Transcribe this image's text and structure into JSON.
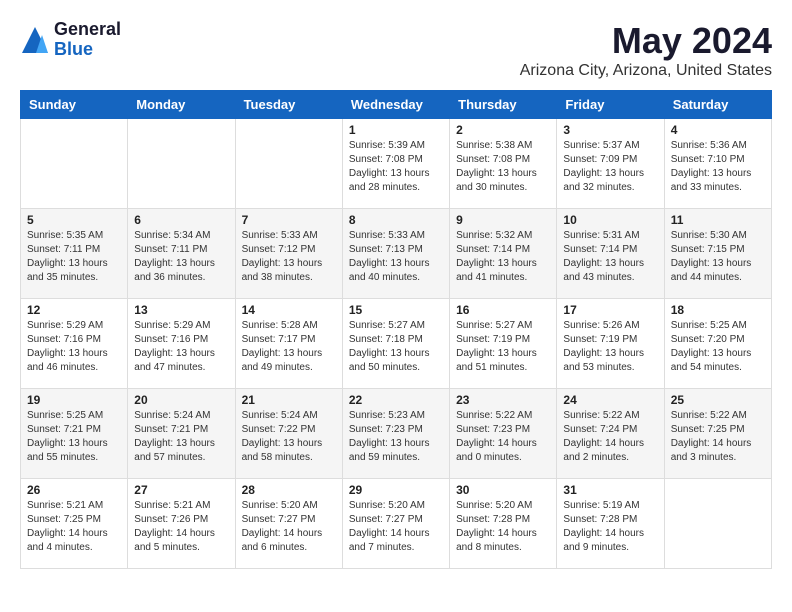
{
  "logo": {
    "general": "General",
    "blue": "Blue"
  },
  "title": "May 2024",
  "location": "Arizona City, Arizona, United States",
  "days_header": [
    "Sunday",
    "Monday",
    "Tuesday",
    "Wednesday",
    "Thursday",
    "Friday",
    "Saturday"
  ],
  "weeks": [
    [
      {
        "day": "",
        "info": ""
      },
      {
        "day": "",
        "info": ""
      },
      {
        "day": "",
        "info": ""
      },
      {
        "day": "1",
        "info": "Sunrise: 5:39 AM\nSunset: 7:08 PM\nDaylight: 13 hours\nand 28 minutes."
      },
      {
        "day": "2",
        "info": "Sunrise: 5:38 AM\nSunset: 7:08 PM\nDaylight: 13 hours\nand 30 minutes."
      },
      {
        "day": "3",
        "info": "Sunrise: 5:37 AM\nSunset: 7:09 PM\nDaylight: 13 hours\nand 32 minutes."
      },
      {
        "day": "4",
        "info": "Sunrise: 5:36 AM\nSunset: 7:10 PM\nDaylight: 13 hours\nand 33 minutes."
      }
    ],
    [
      {
        "day": "5",
        "info": "Sunrise: 5:35 AM\nSunset: 7:11 PM\nDaylight: 13 hours\nand 35 minutes."
      },
      {
        "day": "6",
        "info": "Sunrise: 5:34 AM\nSunset: 7:11 PM\nDaylight: 13 hours\nand 36 minutes."
      },
      {
        "day": "7",
        "info": "Sunrise: 5:33 AM\nSunset: 7:12 PM\nDaylight: 13 hours\nand 38 minutes."
      },
      {
        "day": "8",
        "info": "Sunrise: 5:33 AM\nSunset: 7:13 PM\nDaylight: 13 hours\nand 40 minutes."
      },
      {
        "day": "9",
        "info": "Sunrise: 5:32 AM\nSunset: 7:14 PM\nDaylight: 13 hours\nand 41 minutes."
      },
      {
        "day": "10",
        "info": "Sunrise: 5:31 AM\nSunset: 7:14 PM\nDaylight: 13 hours\nand 43 minutes."
      },
      {
        "day": "11",
        "info": "Sunrise: 5:30 AM\nSunset: 7:15 PM\nDaylight: 13 hours\nand 44 minutes."
      }
    ],
    [
      {
        "day": "12",
        "info": "Sunrise: 5:29 AM\nSunset: 7:16 PM\nDaylight: 13 hours\nand 46 minutes."
      },
      {
        "day": "13",
        "info": "Sunrise: 5:29 AM\nSunset: 7:16 PM\nDaylight: 13 hours\nand 47 minutes."
      },
      {
        "day": "14",
        "info": "Sunrise: 5:28 AM\nSunset: 7:17 PM\nDaylight: 13 hours\nand 49 minutes."
      },
      {
        "day": "15",
        "info": "Sunrise: 5:27 AM\nSunset: 7:18 PM\nDaylight: 13 hours\nand 50 minutes."
      },
      {
        "day": "16",
        "info": "Sunrise: 5:27 AM\nSunset: 7:19 PM\nDaylight: 13 hours\nand 51 minutes."
      },
      {
        "day": "17",
        "info": "Sunrise: 5:26 AM\nSunset: 7:19 PM\nDaylight: 13 hours\nand 53 minutes."
      },
      {
        "day": "18",
        "info": "Sunrise: 5:25 AM\nSunset: 7:20 PM\nDaylight: 13 hours\nand 54 minutes."
      }
    ],
    [
      {
        "day": "19",
        "info": "Sunrise: 5:25 AM\nSunset: 7:21 PM\nDaylight: 13 hours\nand 55 minutes."
      },
      {
        "day": "20",
        "info": "Sunrise: 5:24 AM\nSunset: 7:21 PM\nDaylight: 13 hours\nand 57 minutes."
      },
      {
        "day": "21",
        "info": "Sunrise: 5:24 AM\nSunset: 7:22 PM\nDaylight: 13 hours\nand 58 minutes."
      },
      {
        "day": "22",
        "info": "Sunrise: 5:23 AM\nSunset: 7:23 PM\nDaylight: 13 hours\nand 59 minutes."
      },
      {
        "day": "23",
        "info": "Sunrise: 5:22 AM\nSunset: 7:23 PM\nDaylight: 14 hours\nand 0 minutes."
      },
      {
        "day": "24",
        "info": "Sunrise: 5:22 AM\nSunset: 7:24 PM\nDaylight: 14 hours\nand 2 minutes."
      },
      {
        "day": "25",
        "info": "Sunrise: 5:22 AM\nSunset: 7:25 PM\nDaylight: 14 hours\nand 3 minutes."
      }
    ],
    [
      {
        "day": "26",
        "info": "Sunrise: 5:21 AM\nSunset: 7:25 PM\nDaylight: 14 hours\nand 4 minutes."
      },
      {
        "day": "27",
        "info": "Sunrise: 5:21 AM\nSunset: 7:26 PM\nDaylight: 14 hours\nand 5 minutes."
      },
      {
        "day": "28",
        "info": "Sunrise: 5:20 AM\nSunset: 7:27 PM\nDaylight: 14 hours\nand 6 minutes."
      },
      {
        "day": "29",
        "info": "Sunrise: 5:20 AM\nSunset: 7:27 PM\nDaylight: 14 hours\nand 7 minutes."
      },
      {
        "day": "30",
        "info": "Sunrise: 5:20 AM\nSunset: 7:28 PM\nDaylight: 14 hours\nand 8 minutes."
      },
      {
        "day": "31",
        "info": "Sunrise: 5:19 AM\nSunset: 7:28 PM\nDaylight: 14 hours\nand 9 minutes."
      },
      {
        "day": "",
        "info": ""
      }
    ]
  ]
}
